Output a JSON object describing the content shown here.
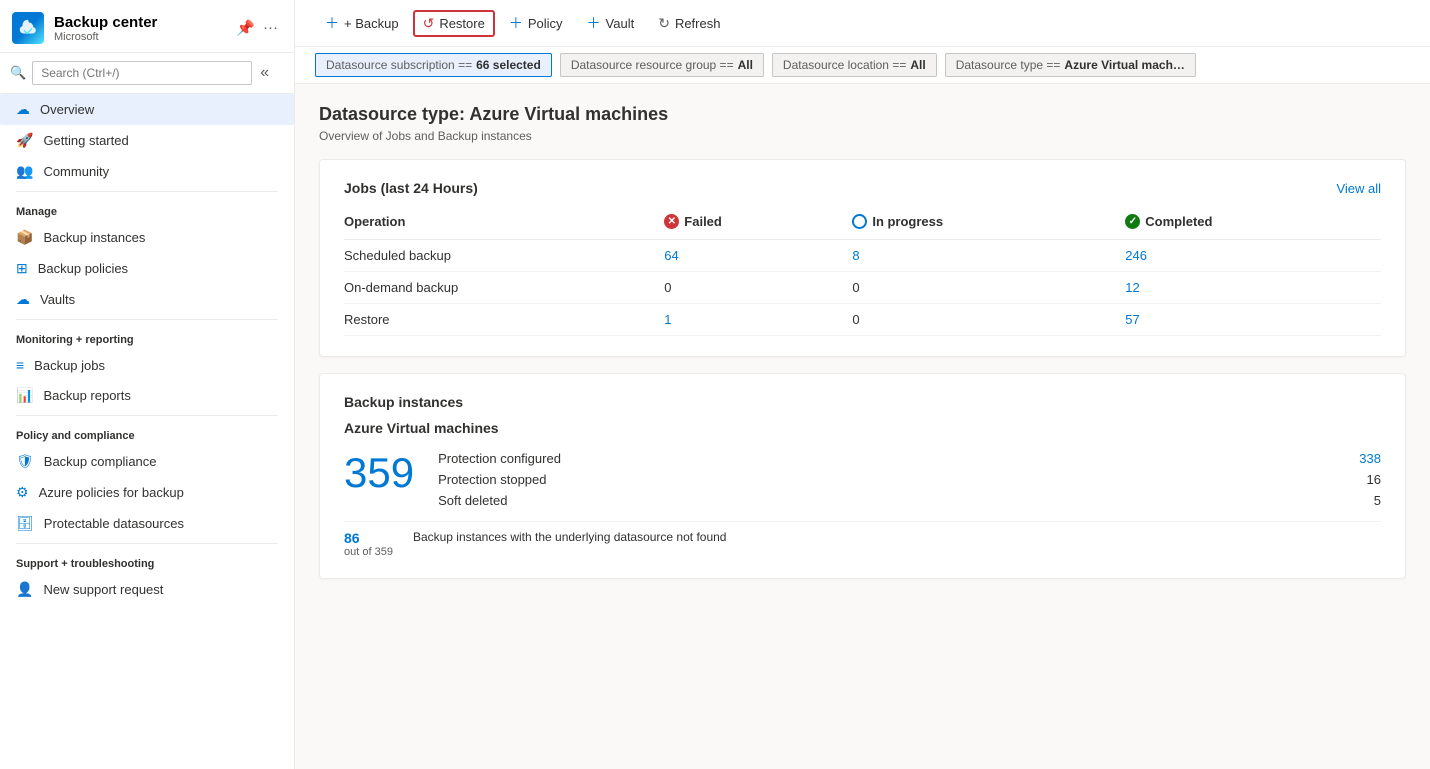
{
  "sidebar": {
    "app_title": "Backup center",
    "app_subtitle": "Microsoft",
    "search_placeholder": "Search (Ctrl+/)",
    "nav_items": [
      {
        "id": "overview",
        "label": "Overview",
        "icon": "cloud-icon",
        "active": true,
        "section": null
      },
      {
        "id": "getting-started",
        "label": "Getting started",
        "icon": "star-icon",
        "active": false,
        "section": null
      },
      {
        "id": "community",
        "label": "Community",
        "icon": "users-icon",
        "active": false,
        "section": null
      }
    ],
    "manage_section": "Manage",
    "manage_items": [
      {
        "id": "backup-instances",
        "label": "Backup instances",
        "icon": "box-icon"
      },
      {
        "id": "backup-policies",
        "label": "Backup policies",
        "icon": "grid-icon"
      },
      {
        "id": "vaults",
        "label": "Vaults",
        "icon": "cloud-sm-icon"
      }
    ],
    "monitoring_section": "Monitoring + reporting",
    "monitoring_items": [
      {
        "id": "backup-jobs",
        "label": "Backup jobs",
        "icon": "list-icon"
      },
      {
        "id": "backup-reports",
        "label": "Backup reports",
        "icon": "chart-icon"
      }
    ],
    "policy_section": "Policy and compliance",
    "policy_items": [
      {
        "id": "backup-compliance",
        "label": "Backup compliance",
        "icon": "shield-icon"
      },
      {
        "id": "azure-policies",
        "label": "Azure policies for backup",
        "icon": "gear-circle-icon"
      },
      {
        "id": "protectable-datasources",
        "label": "Protectable datasources",
        "icon": "db-icon"
      }
    ],
    "support_section": "Support + troubleshooting",
    "support_items": [
      {
        "id": "new-support-request",
        "label": "New support request",
        "icon": "person-icon"
      }
    ]
  },
  "toolbar": {
    "backup_label": "+ Backup",
    "restore_label": "↺  Restore",
    "policy_label": "+ Policy",
    "vault_label": "+ Vault",
    "refresh_label": "Refresh"
  },
  "filters": [
    {
      "id": "subscription",
      "label": "Datasource subscription == ",
      "value": "66 selected",
      "active": true
    },
    {
      "id": "resource-group",
      "label": "Datasource resource group == ",
      "value": "All",
      "active": false
    },
    {
      "id": "location",
      "label": "Datasource location == ",
      "value": "All",
      "active": false
    },
    {
      "id": "type",
      "label": "Datasource type == ",
      "value": "Azure Virtual mach…",
      "active": false
    }
  ],
  "main": {
    "page_title": "Datasource type: Azure Virtual machines",
    "page_subtitle": "Overview of Jobs and Backup instances",
    "jobs_card": {
      "title": "Jobs (last 24 Hours)",
      "view_all": "View all",
      "columns": {
        "operation": "Operation",
        "failed": "Failed",
        "in_progress": "In progress",
        "completed": "Completed"
      },
      "rows": [
        {
          "operation": "Scheduled backup",
          "failed": "64",
          "in_progress": "8",
          "completed": "246",
          "failed_link": true,
          "in_progress_link": true,
          "completed_link": true
        },
        {
          "operation": "On-demand backup",
          "failed": "0",
          "in_progress": "0",
          "completed": "12",
          "failed_link": false,
          "in_progress_link": false,
          "completed_link": true
        },
        {
          "operation": "Restore",
          "failed": "1",
          "in_progress": "0",
          "completed": "57",
          "failed_link": true,
          "in_progress_link": false,
          "completed_link": true
        }
      ]
    },
    "instances_card": {
      "card_title": "Backup instances",
      "section_title": "Azure Virtual machines",
      "total_count": "359",
      "details": [
        {
          "label": "Protection configured",
          "value": "338",
          "is_link": true
        },
        {
          "label": "Protection stopped",
          "value": "16",
          "is_link": false
        },
        {
          "label": "Soft deleted",
          "value": "5",
          "is_link": false
        }
      ],
      "footer_count": "86",
      "footer_sub": "out of 359",
      "footer_desc": "Backup instances with the underlying datasource not found"
    }
  }
}
